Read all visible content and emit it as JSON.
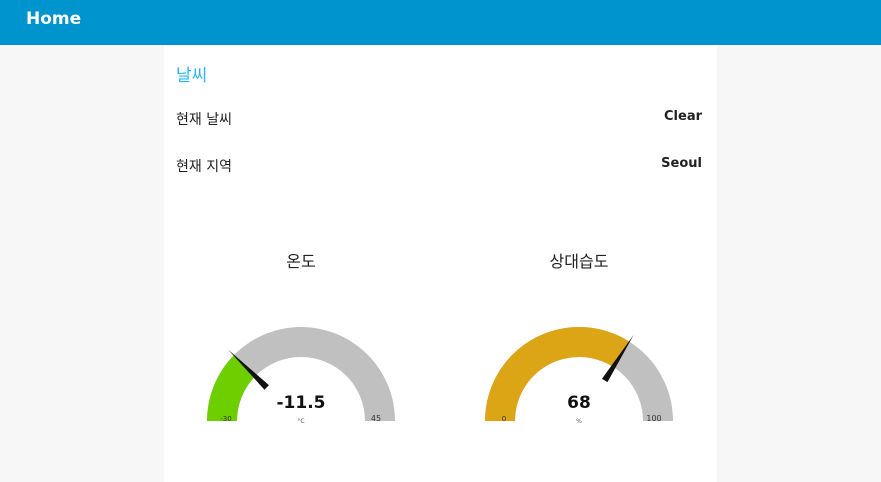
{
  "header": {
    "title": "Home"
  },
  "group": {
    "title": "날씨"
  },
  "weather": {
    "rows": [
      {
        "label": "현재 날씨",
        "value": "Clear"
      },
      {
        "label": "현재 지역",
        "value": "Seoul"
      }
    ]
  },
  "gauges": {
    "temperature": {
      "title": "온도",
      "value": -11.5,
      "value_text": "-11.5",
      "unit": "°C",
      "min": -30,
      "max": 45,
      "min_label": "-30",
      "max_label": "45",
      "fill_color": "#6ecf00"
    },
    "humidity": {
      "title": "상대습도",
      "value": 68,
      "value_text": "68",
      "unit": "%",
      "min": 0,
      "max": 100,
      "min_label": "0",
      "max_label": "100",
      "fill_color": "#dba515"
    }
  },
  "colors": {
    "header_bg": "#0094ce",
    "group_title": "#29b6f6",
    "gauge_track": "#c0c0c0",
    "needle": "#111111"
  }
}
